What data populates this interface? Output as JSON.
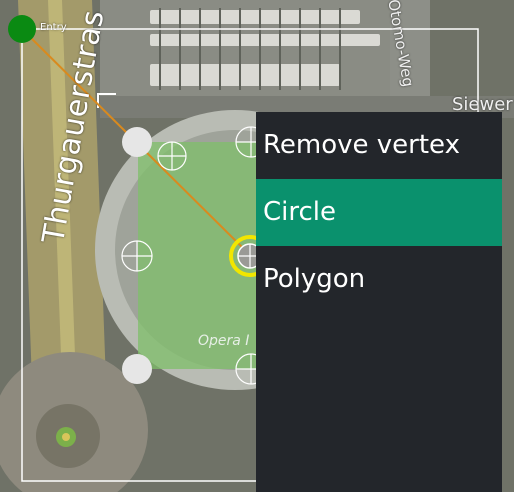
{
  "map": {
    "streets": {
      "thurgauer": "Thurgauerstras",
      "siewer": "Siewer",
      "otomo": "Otomo-Weg"
    },
    "labels": {
      "opera": "Opera I",
      "entry": "Entry"
    }
  },
  "context_menu": {
    "items": [
      {
        "label": "Remove vertex",
        "active": false
      },
      {
        "label": "Circle",
        "active": true
      },
      {
        "label": "Polygon",
        "active": false
      }
    ]
  },
  "colors": {
    "menu_background": "#23262b",
    "menu_active": "#0a916d",
    "zone_fill": "#7fbf6a",
    "route_line": "#d98a1e",
    "entry_marker": "#0a8a12",
    "selected_ring": "#f2e600"
  }
}
